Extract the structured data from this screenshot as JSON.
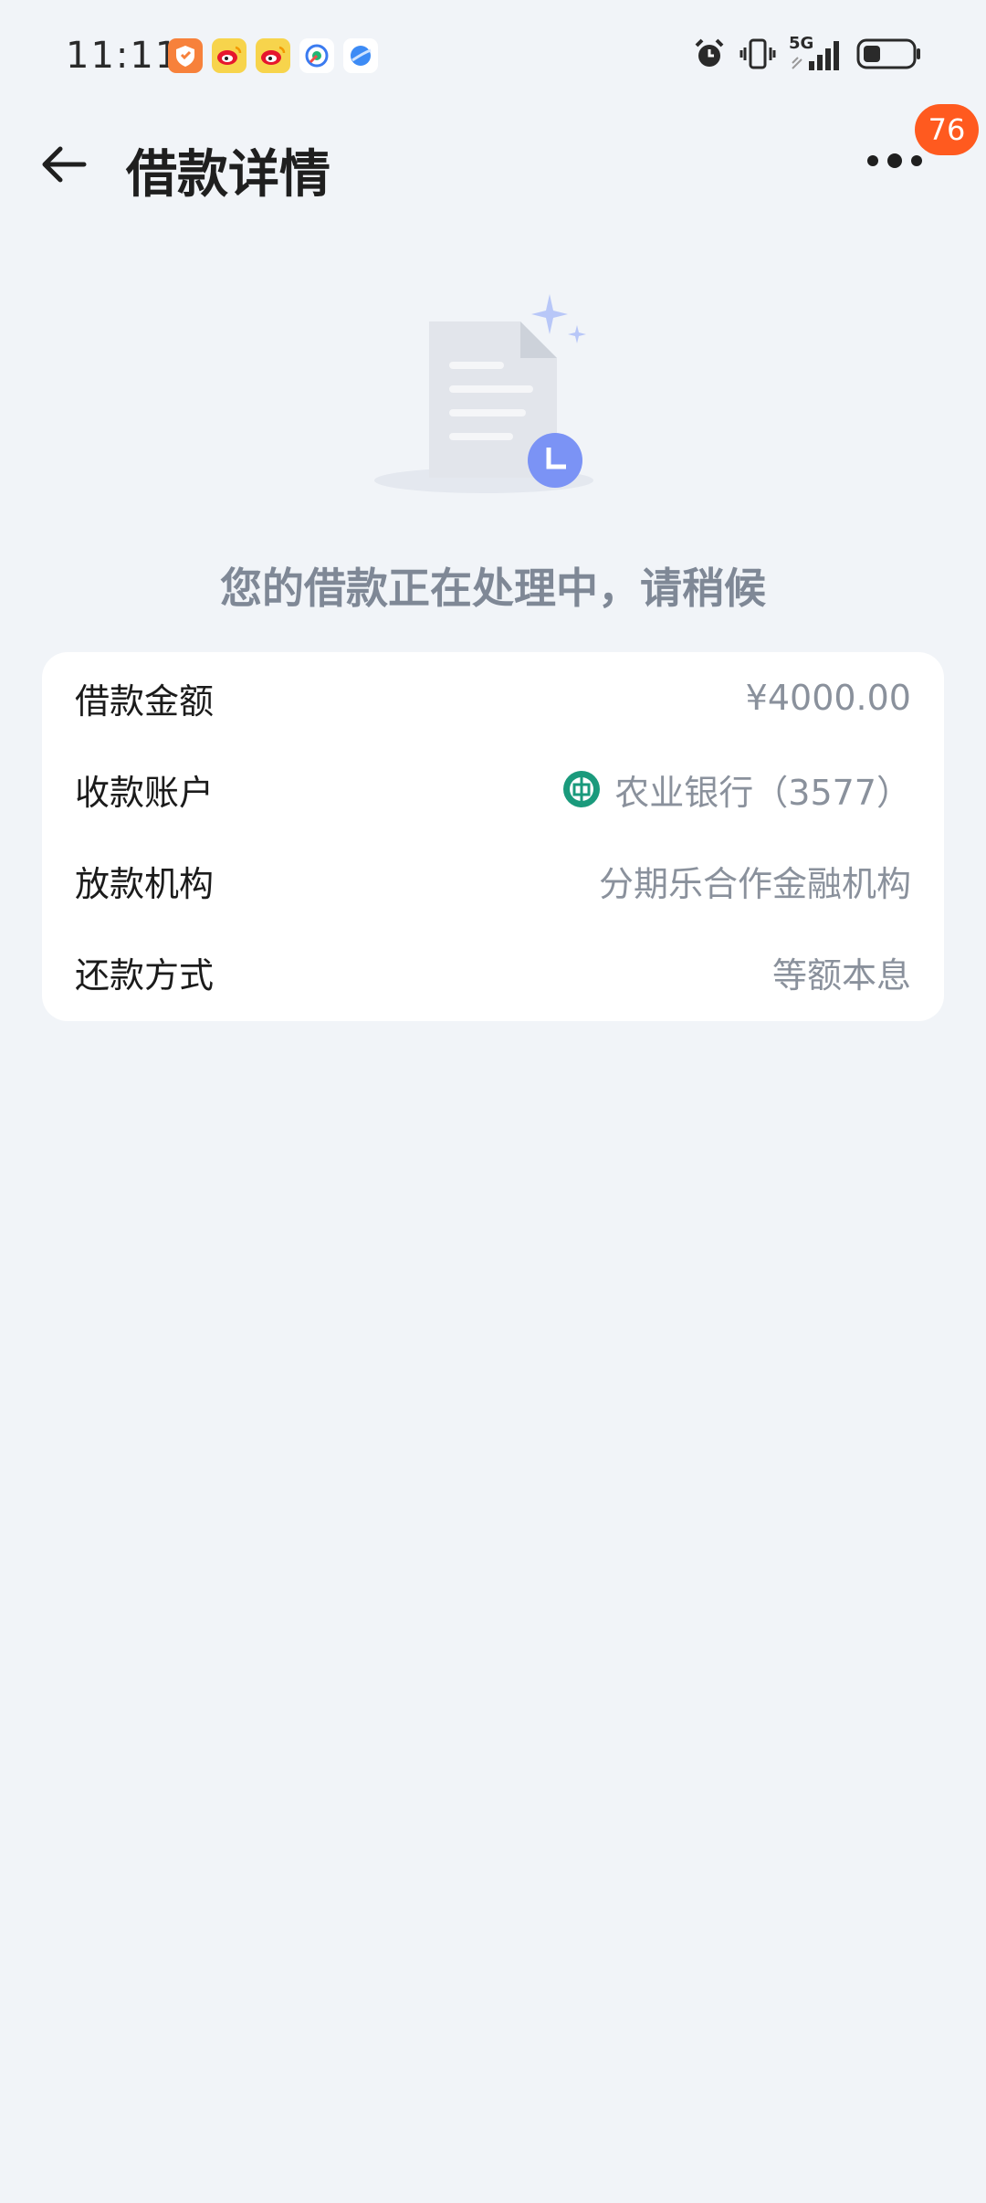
{
  "status_bar": {
    "time": "11:11",
    "notification_icons": [
      "heart-shield-icon",
      "weibo-icon",
      "weibo-icon",
      "camera-app-icon",
      "browser-icon"
    ],
    "system_icons": [
      "alarm-icon",
      "vibrate-icon",
      "signal-5g-icon",
      "battery-icon"
    ],
    "network_label": "5G",
    "battery_level": 0.35
  },
  "header": {
    "title": "借款详情",
    "badge_count": "76"
  },
  "status_message": "您的借款正在处理中，请稍候",
  "details": [
    {
      "label": "借款金额",
      "value": "¥4000.00"
    },
    {
      "label": "收款账户",
      "value": "农业银行（3577）",
      "icon": "abc-bank-logo-icon"
    },
    {
      "label": "放款机构",
      "value": "分期乐合作金融机构"
    },
    {
      "label": "还款方式",
      "value": "等额本息"
    }
  ],
  "colors": {
    "background": "#f1f4f8",
    "badge": "#ff5a1f",
    "clock_accent": "#7b93f5",
    "bank_green": "#1a9a7c",
    "muted_text": "#8a919c"
  }
}
